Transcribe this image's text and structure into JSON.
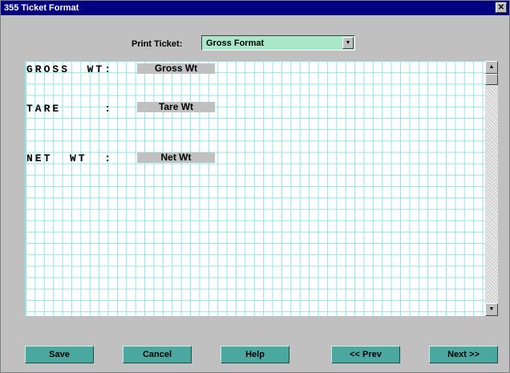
{
  "window": {
    "title": "355 Ticket Format",
    "close_glyph": "✕"
  },
  "print_ticket": {
    "label": "Print Ticket:",
    "selected": "Gross Format",
    "arrow_glyph": "▼"
  },
  "fields": [
    {
      "label": "GROSS  WT:",
      "value": "Gross Wt"
    },
    {
      "label": "TARE     :",
      "value": "Tare Wt"
    },
    {
      "label": "NET  WT  :",
      "value": "Net Wt"
    }
  ],
  "scrollbar": {
    "up_glyph": "▲",
    "down_glyph": "▼"
  },
  "buttons": {
    "save": "Save",
    "cancel": "Cancel",
    "help": "Help",
    "prev": "<< Prev",
    "next": "Next >>"
  },
  "colors": {
    "title_bar": "#000080",
    "grid_line": "#8fe6e6",
    "button": "#4aa8a0",
    "select_bg": "#a8e8c8"
  }
}
